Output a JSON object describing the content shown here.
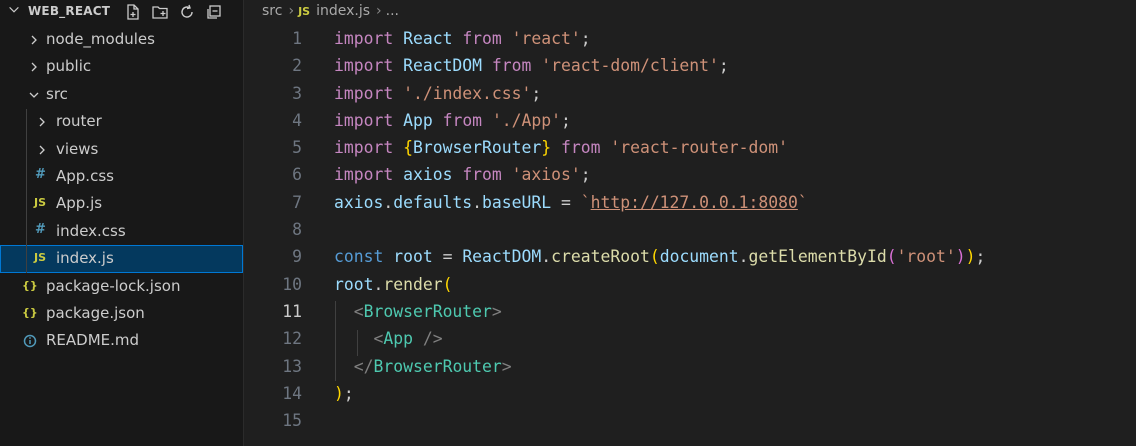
{
  "explorer": {
    "title": "WEB_REACT",
    "actions": [
      "new-file-icon",
      "new-folder-icon",
      "refresh-icon",
      "collapse-all-icon"
    ],
    "items": [
      {
        "label": "node_modules",
        "kind": "folder",
        "expanded": false,
        "depth": 0
      },
      {
        "label": "public",
        "kind": "folder",
        "expanded": false,
        "depth": 0
      },
      {
        "label": "src",
        "kind": "folder",
        "expanded": true,
        "depth": 0
      },
      {
        "label": "router",
        "kind": "folder",
        "expanded": false,
        "depth": 1
      },
      {
        "label": "views",
        "kind": "folder",
        "expanded": false,
        "depth": 1
      },
      {
        "label": "App.css",
        "kind": "css",
        "badge": "#",
        "depth": 1
      },
      {
        "label": "App.js",
        "kind": "js",
        "badge": "JS",
        "depth": 1
      },
      {
        "label": "index.css",
        "kind": "css",
        "badge": "#",
        "depth": 1
      },
      {
        "label": "index.js",
        "kind": "js",
        "badge": "JS",
        "depth": 1,
        "selected": true
      },
      {
        "label": "package-lock.json",
        "kind": "json",
        "badge": "{}",
        "depth": 0
      },
      {
        "label": "package.json",
        "kind": "json",
        "badge": "{}",
        "depth": 0
      },
      {
        "label": "README.md",
        "kind": "md",
        "depth": 0
      }
    ]
  },
  "breadcrumb": {
    "folder": "src",
    "file_badge": "JS",
    "file": "index.js",
    "more": "..."
  },
  "editor": {
    "active_line": 11,
    "lines": [
      {
        "n": "1",
        "tokens": [
          [
            "kw",
            "import"
          ],
          [
            "p",
            " "
          ],
          [
            "ty",
            "React"
          ],
          [
            "p",
            " "
          ],
          [
            "kw",
            "from"
          ],
          [
            "p",
            " "
          ],
          [
            "str",
            "'react'"
          ],
          [
            "p",
            ";"
          ]
        ]
      },
      {
        "n": "2",
        "tokens": [
          [
            "kw",
            "import"
          ],
          [
            "p",
            " "
          ],
          [
            "ty",
            "ReactDOM"
          ],
          [
            "p",
            " "
          ],
          [
            "kw",
            "from"
          ],
          [
            "p",
            " "
          ],
          [
            "str",
            "'react-dom/client'"
          ],
          [
            "p",
            ";"
          ]
        ]
      },
      {
        "n": "3",
        "tokens": [
          [
            "kw",
            "import"
          ],
          [
            "p",
            " "
          ],
          [
            "str",
            "'./index.css'"
          ],
          [
            "p",
            ";"
          ]
        ]
      },
      {
        "n": "4",
        "tokens": [
          [
            "kw",
            "import"
          ],
          [
            "p",
            " "
          ],
          [
            "ty",
            "App"
          ],
          [
            "p",
            " "
          ],
          [
            "kw",
            "from"
          ],
          [
            "p",
            " "
          ],
          [
            "str",
            "'./App'"
          ],
          [
            "p",
            ";"
          ]
        ]
      },
      {
        "n": "5",
        "tokens": [
          [
            "kw",
            "import"
          ],
          [
            "p",
            " "
          ],
          [
            "bk",
            "{"
          ],
          [
            "ty",
            "BrowserRouter"
          ],
          [
            "bk",
            "}"
          ],
          [
            "p",
            " "
          ],
          [
            "kw",
            "from"
          ],
          [
            "p",
            " "
          ],
          [
            "str",
            "'react-router-dom'"
          ]
        ]
      },
      {
        "n": "6",
        "tokens": [
          [
            "kw",
            "import"
          ],
          [
            "p",
            " "
          ],
          [
            "ty",
            "axios"
          ],
          [
            "p",
            " "
          ],
          [
            "kw",
            "from"
          ],
          [
            "p",
            " "
          ],
          [
            "str",
            "'axios'"
          ],
          [
            "p",
            ";"
          ]
        ]
      },
      {
        "n": "7",
        "tokens": [
          [
            "ty",
            "axios"
          ],
          [
            "p",
            "."
          ],
          [
            "ty",
            "defaults"
          ],
          [
            "p",
            "."
          ],
          [
            "ty",
            "baseURL"
          ],
          [
            "p",
            " = "
          ],
          [
            "str",
            "`"
          ],
          [
            "url",
            "http://127.0.0.1:8080"
          ],
          [
            "str",
            "`"
          ]
        ]
      },
      {
        "n": "8",
        "tokens": []
      },
      {
        "n": "9",
        "tokens": [
          [
            "ctk",
            "const"
          ],
          [
            "p",
            " "
          ],
          [
            "ty",
            "root"
          ],
          [
            "p",
            " = "
          ],
          [
            "ty",
            "ReactDOM"
          ],
          [
            "p",
            "."
          ],
          [
            "fn",
            "createRoot"
          ],
          [
            "bk",
            "("
          ],
          [
            "ty",
            "document"
          ],
          [
            "p",
            "."
          ],
          [
            "fn",
            "getElementById"
          ],
          [
            "bk2",
            "("
          ],
          [
            "str",
            "'root'"
          ],
          [
            "bk2",
            ")"
          ],
          [
            "bk",
            ")"
          ],
          [
            "p",
            ";"
          ]
        ]
      },
      {
        "n": "10",
        "tokens": [
          [
            "ty",
            "root"
          ],
          [
            "p",
            "."
          ],
          [
            "fn",
            "render"
          ],
          [
            "bk",
            "("
          ]
        ]
      },
      {
        "n": "11",
        "tokens": [
          [
            "p",
            "  "
          ],
          [
            "ang",
            "<"
          ],
          [
            "tag",
            "BrowserRouter"
          ],
          [
            "ang",
            ">"
          ]
        ]
      },
      {
        "n": "12",
        "tokens": [
          [
            "p",
            "    "
          ],
          [
            "ang",
            "<"
          ],
          [
            "tag",
            "App"
          ],
          [
            "p",
            " "
          ],
          [
            "ang",
            "/>"
          ]
        ]
      },
      {
        "n": "13",
        "tokens": [
          [
            "p",
            "  "
          ],
          [
            "ang",
            "</"
          ],
          [
            "tag",
            "BrowserRouter"
          ],
          [
            "ang",
            ">"
          ]
        ]
      },
      {
        "n": "14",
        "tokens": [
          [
            "bk",
            ")"
          ],
          [
            "p",
            ";"
          ]
        ]
      },
      {
        "n": "15",
        "tokens": []
      }
    ]
  },
  "colors": {
    "editor_bg": "#1f1f1f",
    "sidebar_bg": "#181818",
    "selection_bg": "#04395e",
    "selection_border": "#0078d4"
  }
}
